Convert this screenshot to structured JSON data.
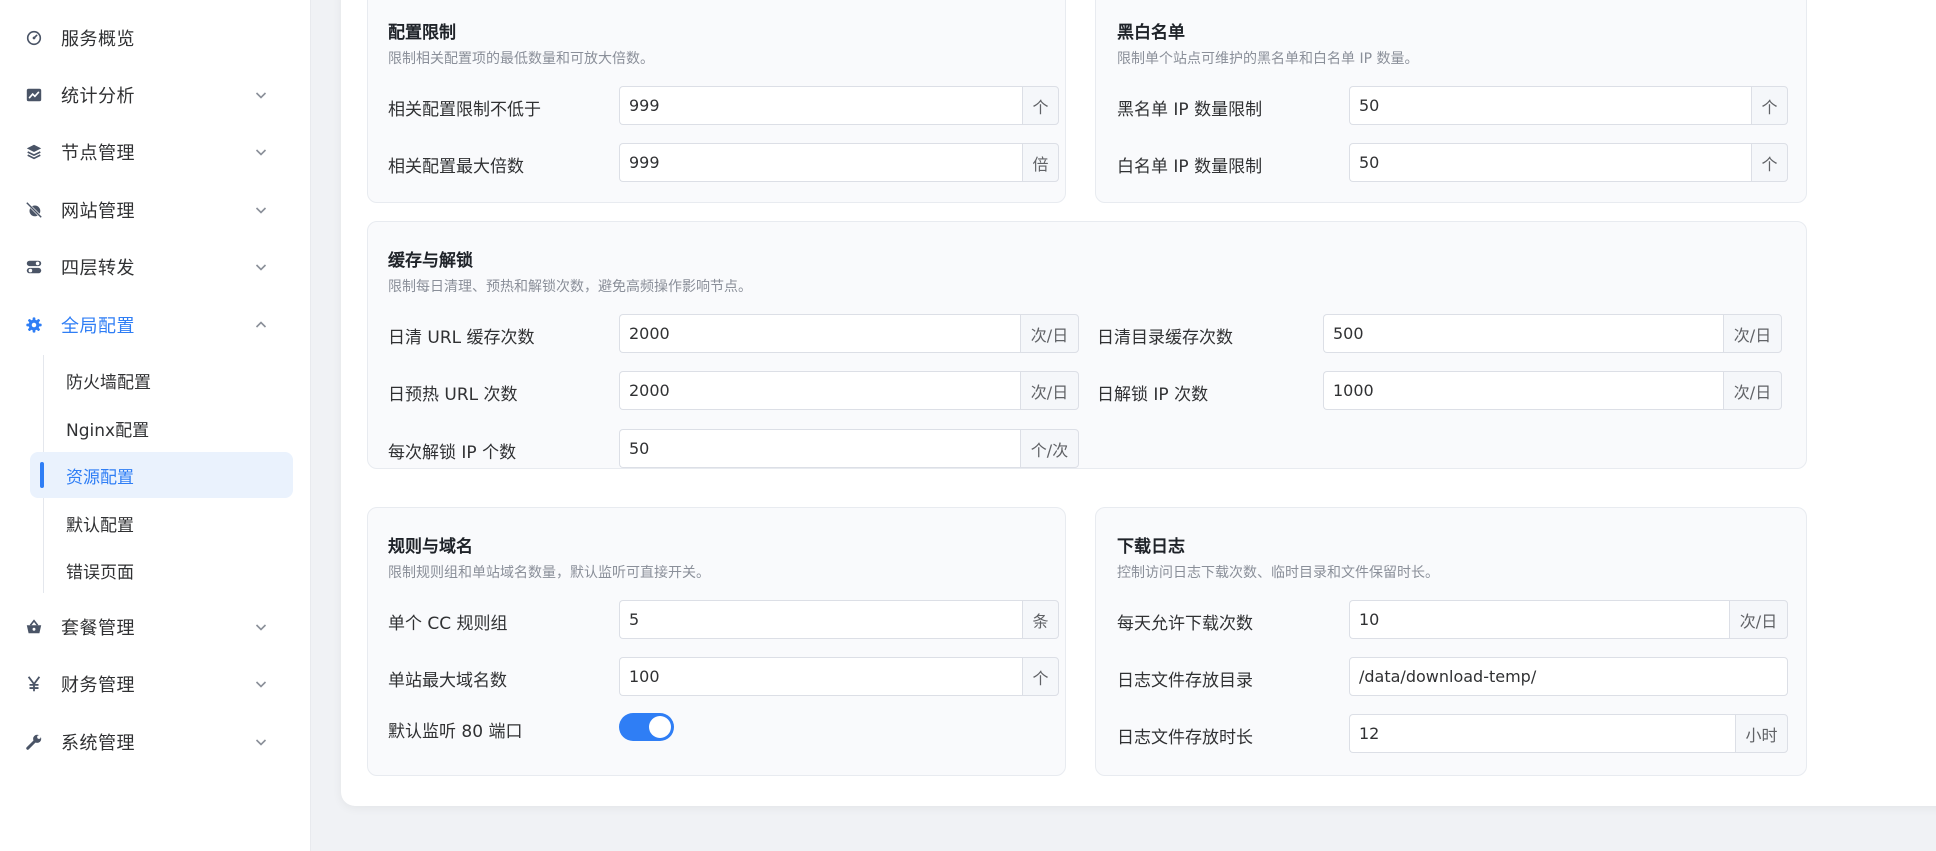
{
  "sidebar": {
    "items": [
      {
        "label": "服务概览",
        "icon": "dashboard-icon"
      },
      {
        "label": "统计分析",
        "icon": "chart-icon"
      },
      {
        "label": "节点管理",
        "icon": "layers-icon"
      },
      {
        "label": "网站管理",
        "icon": "globe-off-icon"
      },
      {
        "label": "四层转发",
        "icon": "toggle-icon"
      },
      {
        "label": "全局配置",
        "icon": "gear-icon"
      },
      {
        "label": "套餐管理",
        "icon": "basket-icon"
      },
      {
        "label": "财务管理",
        "icon": "yen-icon"
      },
      {
        "label": "系统管理",
        "icon": "wrench-icon"
      }
    ],
    "sub_items": [
      {
        "label": "防火墙配置"
      },
      {
        "label": "Nginx配置"
      },
      {
        "label": "资源配置"
      },
      {
        "label": "默认配置"
      },
      {
        "label": "错误页面"
      }
    ],
    "active_item": "全局配置",
    "active_sub_item": "资源配置"
  },
  "panels": {
    "config_limit": {
      "title": "配置限制",
      "desc": "限制相关配置项的最低数量和可放大倍数。",
      "fields": [
        {
          "label": "相关配置限制不低于",
          "value": "999",
          "unit": "个"
        },
        {
          "label": "相关配置最大倍数",
          "value": "999",
          "unit": "倍"
        }
      ]
    },
    "blackwhite": {
      "title": "黑白名单",
      "desc": "限制单个站点可维护的黑名单和白名单 IP 数量。",
      "fields": [
        {
          "label": "黑名单 IP 数量限制",
          "value": "50",
          "unit": "个"
        },
        {
          "label": "白名单 IP 数量限制",
          "value": "50",
          "unit": "个"
        }
      ]
    },
    "cache": {
      "title": "缓存与解锁",
      "desc": "限制每日清理、预热和解锁次数，避免高频操作影响节点。",
      "fields": [
        {
          "label": "日清 URL 缓存次数",
          "value": "2000",
          "unit": "次/日"
        },
        {
          "label": "日清目录缓存次数",
          "value": "500",
          "unit": "次/日"
        },
        {
          "label": "日预热 URL 次数",
          "value": "2000",
          "unit": "次/日"
        },
        {
          "label": "日解锁 IP 次数",
          "value": "1000",
          "unit": "次/日"
        },
        {
          "label": "每次解锁 IP 个数",
          "value": "50",
          "unit": "个/次"
        }
      ]
    },
    "rules": {
      "title": "规则与域名",
      "desc": "限制规则组和单站域名数量，默认监听可直接开关。",
      "fields": [
        {
          "label": "单个 CC 规则组",
          "value": "5",
          "unit": "条"
        },
        {
          "label": "单站最大域名数",
          "value": "100",
          "unit": "个"
        }
      ],
      "toggle": {
        "label": "默认监听 80 端口",
        "on": true
      }
    },
    "download": {
      "title": "下载日志",
      "desc": "控制访问日志下载次数、临时目录和文件保留时长。",
      "fields": [
        {
          "label": "每天允许下载次数",
          "value": "10",
          "unit": "次/日"
        },
        {
          "label": "日志文件存放目录",
          "value": "/data/download-temp/"
        },
        {
          "label": "日志文件存放时长",
          "value": "12",
          "unit": "小时"
        }
      ]
    }
  },
  "colors": {
    "accent": "#2f7ef5",
    "active_bg": "#eaf2fd",
    "panel_bg": "#f9fafc",
    "page_bg": "#f0f2f5"
  }
}
